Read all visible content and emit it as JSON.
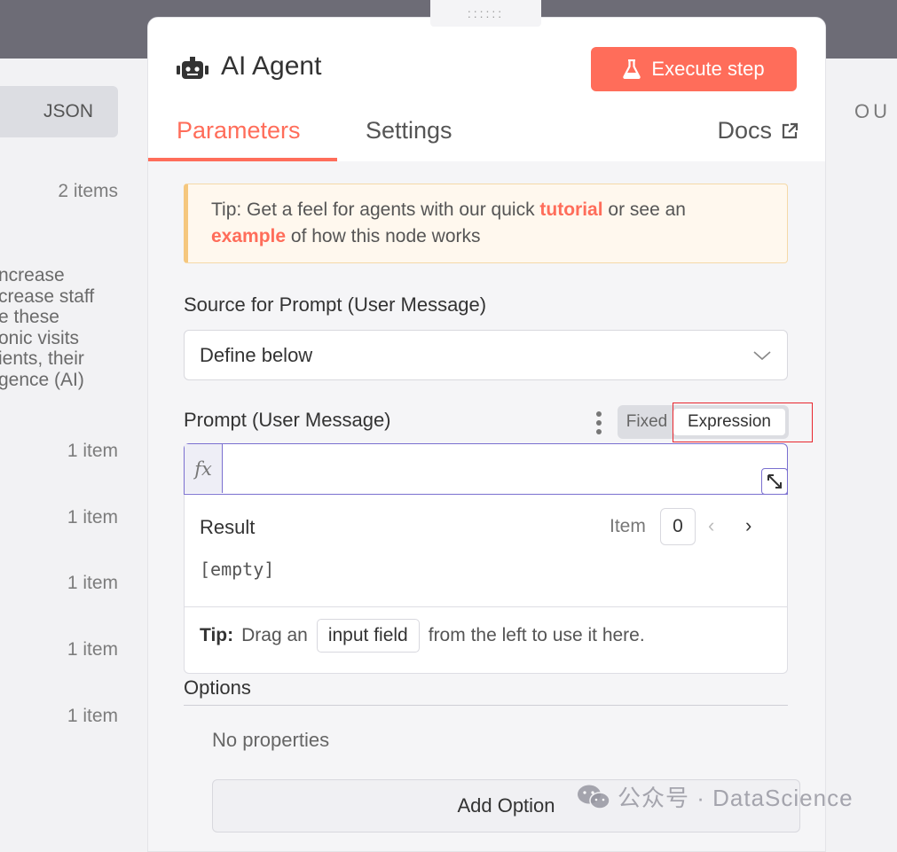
{
  "left_panel": {
    "json_button": "JSON",
    "top_count": "2 items",
    "text_lines": [
      "ncrease",
      "crease staff",
      "e these",
      "onic visits",
      "ients, their",
      "gence (AI)"
    ],
    "item_counts": [
      "1 item",
      "1 item",
      "1 item",
      "1 item",
      "1 item"
    ]
  },
  "right_panel": {
    "label": "OU"
  },
  "drag_handle": "::::::",
  "node": {
    "title": "AI Agent",
    "icon": "robot-icon",
    "execute_button": "Execute step",
    "execute_icon": "flask-icon",
    "tabs": [
      {
        "label": "Parameters",
        "active": true
      },
      {
        "label": "Settings",
        "active": false
      }
    ],
    "docs_label": "Docs",
    "accent_color": "#ff6d5a"
  },
  "tip": {
    "prefix": "Tip: Get a feel for agents with our quick ",
    "link1": "tutorial",
    "middle": " or see an",
    "link2": "example",
    "suffix": " of how this node works"
  },
  "source_field": {
    "label": "Source for Prompt (User Message)",
    "value": "Define below"
  },
  "prompt_field": {
    "label": "Prompt (User Message)",
    "mode_fixed": "Fixed",
    "mode_expression": "Expression",
    "fx_label": "fx",
    "value": ""
  },
  "result": {
    "title": "Result",
    "item_label": "Item",
    "item_index": "0",
    "value": "[empty]",
    "tip_label": "Tip:",
    "tip_before": "Drag an",
    "tip_pill": "input field",
    "tip_after": "from the left to use it here."
  },
  "options": {
    "label": "Options",
    "empty_text": "No properties",
    "add_button": "Add Option"
  },
  "watermark": "公众号 · DataScience"
}
